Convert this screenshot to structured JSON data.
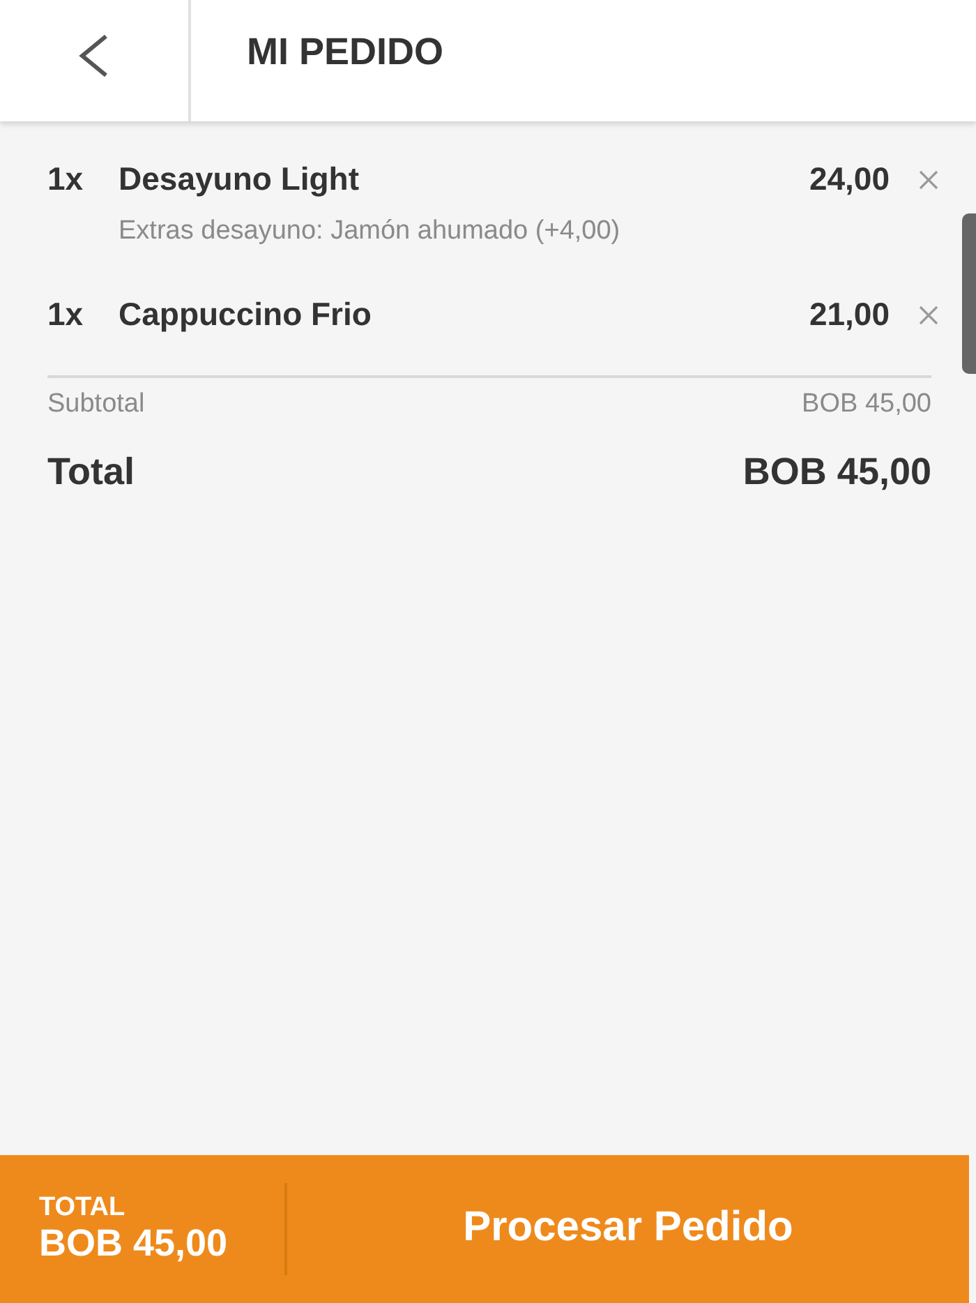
{
  "header": {
    "title": "MI PEDIDO"
  },
  "items": [
    {
      "qty": "1x",
      "name": "Desayuno Light",
      "price": "24,00",
      "note": "Extras desayuno: Jamón ahumado (+4,00)"
    },
    {
      "qty": "1x",
      "name": "Cappuccino Frio",
      "price": "21,00"
    }
  ],
  "summary": {
    "subtotal_label": "Subtotal",
    "subtotal": "BOB 45,00",
    "total_label": "Total",
    "total": "BOB 45,00"
  },
  "footer": {
    "total_label": "TOTAL",
    "total": "BOB 45,00",
    "button": "Procesar Pedido"
  }
}
